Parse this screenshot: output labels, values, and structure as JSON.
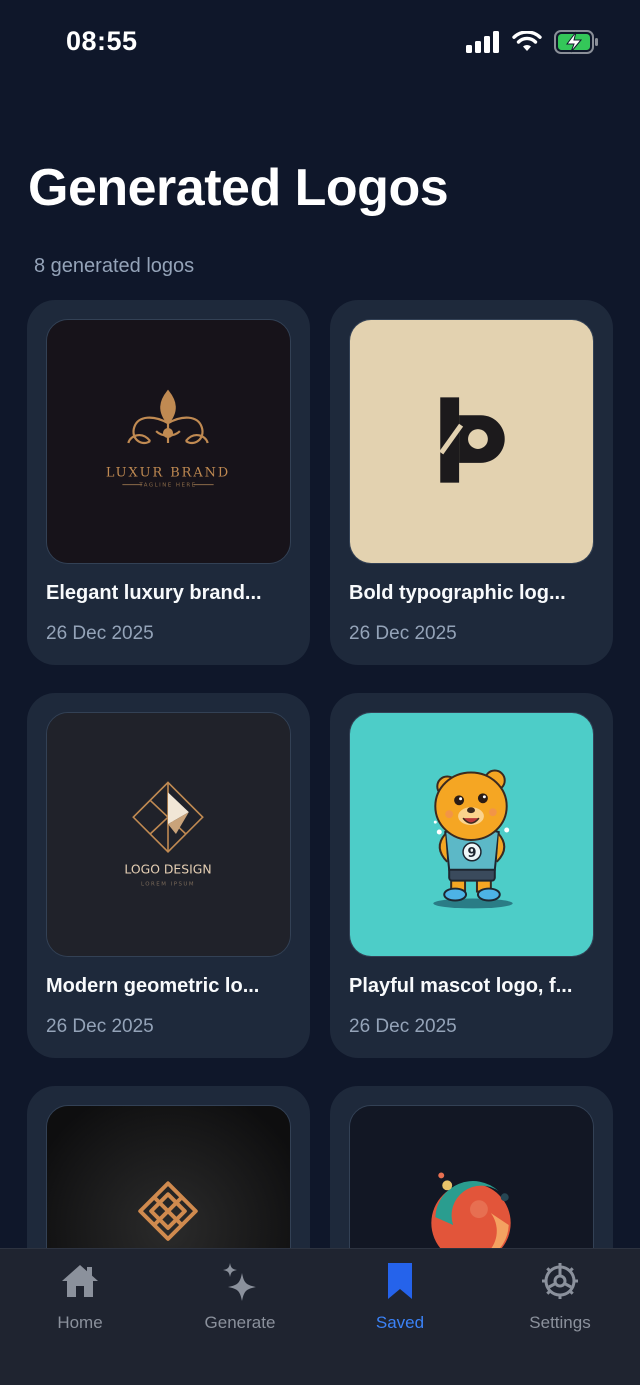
{
  "status": {
    "time": "08:55"
  },
  "header": {
    "title": "Generated Logos",
    "subtitle": "8 generated logos"
  },
  "logos": [
    {
      "title": "Elegant luxury brand...",
      "date": "26 Dec 2025",
      "text": "LUXUR BRAND",
      "subtext": "TAGLINE HERE"
    },
    {
      "title": "Bold typographic log...",
      "date": "26 Dec 2025"
    },
    {
      "title": "Modern geometric lo...",
      "date": "26 Dec 2025",
      "text": "LOGO DESIGN",
      "subtext": "LOREM IPSUM"
    },
    {
      "title": "Playful mascot logo, f...",
      "date": "26 Dec 2025"
    },
    {
      "title": "",
      "date": ""
    },
    {
      "title": "",
      "date": ""
    }
  ],
  "tabs": [
    {
      "label": "Home",
      "icon": "home-icon"
    },
    {
      "label": "Generate",
      "icon": "sparkles-icon"
    },
    {
      "label": "Saved",
      "icon": "bookmark-icon",
      "active": true
    },
    {
      "label": "Settings",
      "icon": "gear-icon"
    }
  ],
  "colors": {
    "background": "#0f172a",
    "card": "#1e293b",
    "accent": "#3b82f6",
    "muted": "#94a3b8"
  }
}
